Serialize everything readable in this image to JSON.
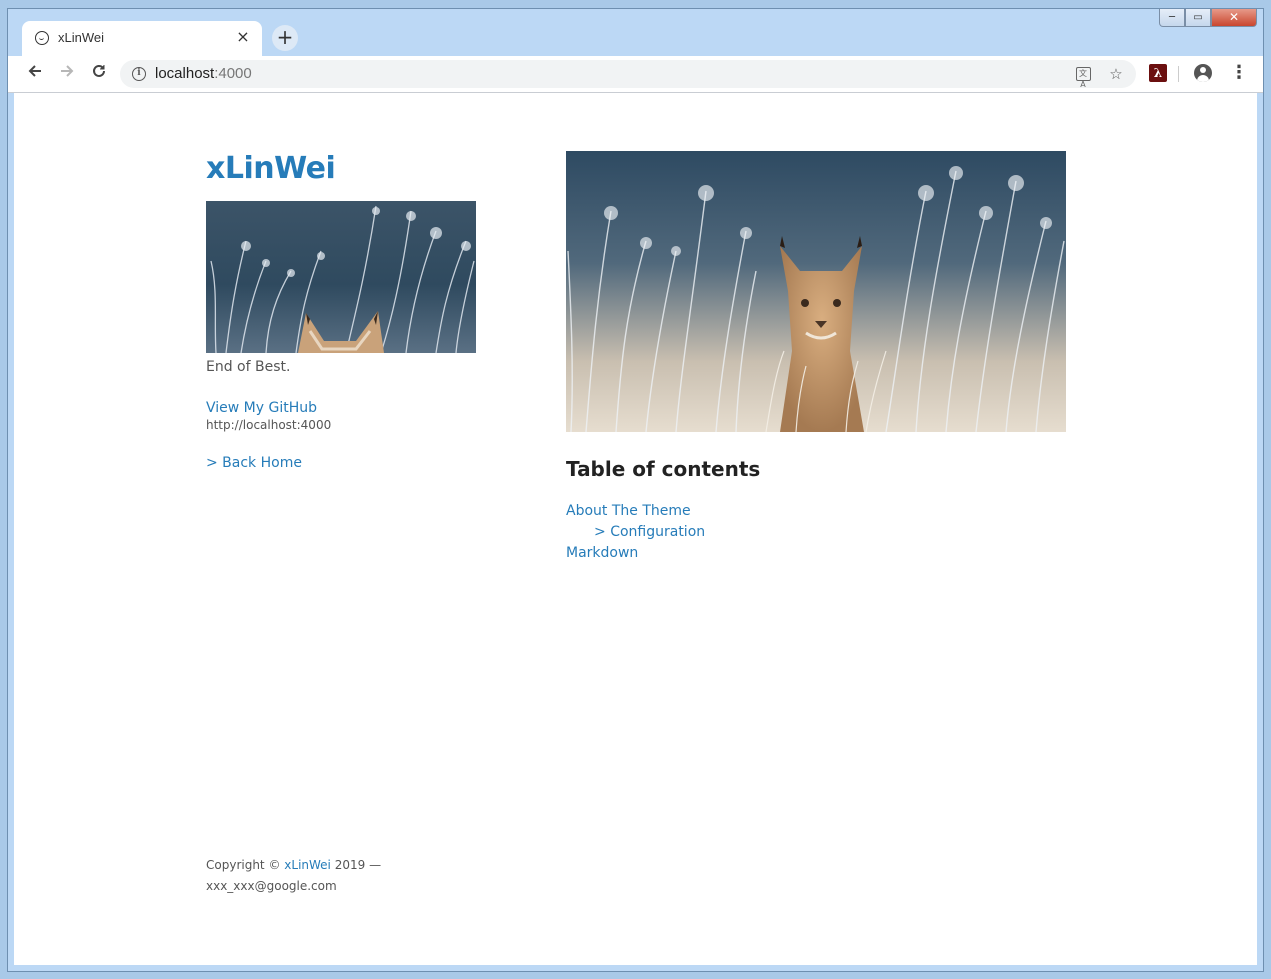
{
  "browser": {
    "tab_title": "xLinWei",
    "tab_close": "×",
    "new_tab": "+",
    "url_host": "localhost",
    "url_port": ":4000",
    "window_controls": {
      "minimize": "─",
      "restore": "▭",
      "close": "✕"
    }
  },
  "sidebar": {
    "site_title": "xLinWei",
    "tagline": "End of Best.",
    "github_link": "View My GitHub",
    "github_url": "http://localhost:4000",
    "back_home": "> Back Home"
  },
  "main": {
    "toc_heading": "Table of contents",
    "toc_items": [
      {
        "label": "About The Theme",
        "level": 1
      },
      {
        "prefix": ">",
        "label": "Configuration",
        "level": 2
      },
      {
        "label": "Markdown",
        "level": 1
      }
    ]
  },
  "footer": {
    "copyright_prefix": "Copyright ©",
    "author": "xLinWei",
    "year_suffix": "2019 —",
    "email": "xxx_xxx@google.com"
  },
  "colors": {
    "link": "#267CB9",
    "text": "#555555",
    "heading": "#222222",
    "browser_frame": "#bcd8f5"
  },
  "icons": [
    "chat-bubble-icon",
    "close-icon",
    "plus-icon",
    "back-arrow-icon",
    "forward-arrow-icon",
    "reload-icon",
    "info-icon",
    "translate-icon",
    "star-icon",
    "pdf-extension-icon",
    "profile-icon",
    "menu-dots-icon"
  ]
}
